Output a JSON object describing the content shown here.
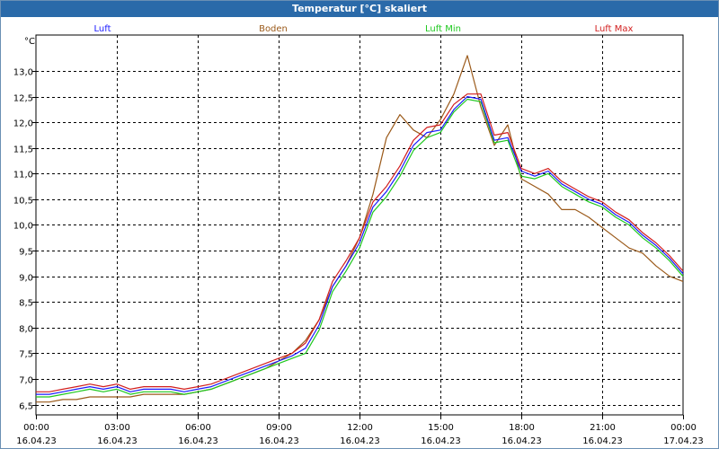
{
  "window": {
    "title": "Temperatur [°C] skaliert"
  },
  "colors": {
    "titlebar": "#2a6aa9",
    "luft": "#1a1aff",
    "boden": "#9b5a1a",
    "luft_min": "#1ec81e",
    "luft_max": "#d21e1e",
    "grid": "#000000"
  },
  "chart_data": {
    "type": "line",
    "title": "Temperatur [°C] skaliert",
    "ylabel": "°C",
    "xlabel": "",
    "ylim": [
      6.3,
      13.7
    ],
    "xlim": [
      0,
      24
    ],
    "grid": true,
    "legend_position": "top",
    "y_ticks": [
      "6,5",
      "7,0",
      "7,5",
      "8,0",
      "8,5",
      "9,0",
      "9,5",
      "10,0",
      "10,5",
      "11,0",
      "11,5",
      "12,0",
      "12,5",
      "13,0"
    ],
    "y_tick_values": [
      6.5,
      7.0,
      7.5,
      8.0,
      8.5,
      9.0,
      9.5,
      10.0,
      10.5,
      11.0,
      11.5,
      12.0,
      12.5,
      13.0
    ],
    "x_tick_hours": [
      0,
      3,
      6,
      9,
      12,
      15,
      18,
      21,
      24
    ],
    "x_ticks": [
      {
        "time": "00:00",
        "date": "16.04.23"
      },
      {
        "time": "03:00",
        "date": "16.04.23"
      },
      {
        "time": "06:00",
        "date": "16.04.23"
      },
      {
        "time": "09:00",
        "date": "16.04.23"
      },
      {
        "time": "12:00",
        "date": "16.04.23"
      },
      {
        "time": "15:00",
        "date": "16.04.23"
      },
      {
        "time": "18:00",
        "date": "16.04.23"
      },
      {
        "time": "21:00",
        "date": "16.04.23"
      },
      {
        "time": "00:00",
        "date": "17.04.23"
      }
    ],
    "x": [
      0,
      0.5,
      1,
      1.5,
      2,
      2.5,
      3,
      3.5,
      4,
      4.5,
      5,
      5.5,
      6,
      6.5,
      7,
      7.5,
      8,
      8.5,
      9,
      9.5,
      10,
      10.5,
      11,
      11.5,
      12,
      12.5,
      13,
      13.5,
      14,
      14.5,
      15,
      15.5,
      16,
      16.5,
      17,
      17.5,
      18,
      18.5,
      19,
      19.5,
      20,
      20.5,
      21,
      21.5,
      22,
      22.5,
      23,
      23.5,
      24
    ],
    "series": [
      {
        "name": "Luft",
        "color": "#1a1aff",
        "values": [
          6.7,
          6.7,
          6.75,
          6.8,
          6.85,
          6.8,
          6.85,
          6.75,
          6.8,
          6.8,
          6.8,
          6.75,
          6.8,
          6.85,
          6.95,
          7.05,
          7.15,
          7.25,
          7.35,
          7.45,
          7.6,
          8.05,
          8.8,
          9.2,
          9.65,
          10.35,
          10.65,
          11.05,
          11.55,
          11.8,
          11.85,
          12.25,
          12.5,
          12.45,
          11.65,
          11.7,
          11.05,
          10.95,
          11.05,
          10.8,
          10.65,
          10.5,
          10.4,
          10.2,
          10.05,
          9.8,
          9.6,
          9.35,
          9.05
        ]
      },
      {
        "name": "Boden",
        "color": "#9b5a1a",
        "values": [
          6.55,
          6.55,
          6.6,
          6.6,
          6.65,
          6.65,
          6.65,
          6.65,
          6.7,
          6.7,
          6.7,
          6.7,
          6.75,
          6.8,
          6.9,
          7.0,
          7.1,
          7.2,
          7.35,
          7.5,
          7.75,
          8.15,
          8.8,
          9.2,
          9.75,
          10.6,
          11.7,
          12.15,
          11.85,
          11.7,
          12.05,
          12.55,
          13.3,
          12.3,
          11.55,
          11.95,
          10.9,
          10.75,
          10.6,
          10.3,
          10.3,
          10.15,
          9.95,
          9.75,
          9.55,
          9.45,
          9.2,
          9.0,
          8.9
        ]
      },
      {
        "name": "Luft Min",
        "color": "#1ec81e",
        "values": [
          6.65,
          6.65,
          6.7,
          6.75,
          6.8,
          6.75,
          6.8,
          6.7,
          6.75,
          6.75,
          6.75,
          6.7,
          6.75,
          6.8,
          6.9,
          7.0,
          7.1,
          7.2,
          7.3,
          7.4,
          7.5,
          7.95,
          8.7,
          9.1,
          9.55,
          10.25,
          10.55,
          10.95,
          11.45,
          11.7,
          11.8,
          12.2,
          12.45,
          12.4,
          11.6,
          11.65,
          10.95,
          10.9,
          11.0,
          10.75,
          10.6,
          10.45,
          10.35,
          10.15,
          10.0,
          9.75,
          9.55,
          9.3,
          9.0
        ]
      },
      {
        "name": "Luft Max",
        "color": "#d21e1e",
        "values": [
          6.75,
          6.75,
          6.8,
          6.85,
          6.9,
          6.85,
          6.9,
          6.8,
          6.85,
          6.85,
          6.85,
          6.8,
          6.85,
          6.9,
          7.0,
          7.1,
          7.2,
          7.3,
          7.4,
          7.5,
          7.7,
          8.15,
          8.9,
          9.3,
          9.75,
          10.45,
          10.75,
          11.15,
          11.65,
          11.9,
          11.95,
          12.35,
          12.55,
          12.55,
          11.75,
          11.8,
          11.1,
          11.0,
          11.1,
          10.85,
          10.7,
          10.55,
          10.45,
          10.25,
          10.1,
          9.85,
          9.65,
          9.4,
          9.1
        ]
      }
    ]
  }
}
